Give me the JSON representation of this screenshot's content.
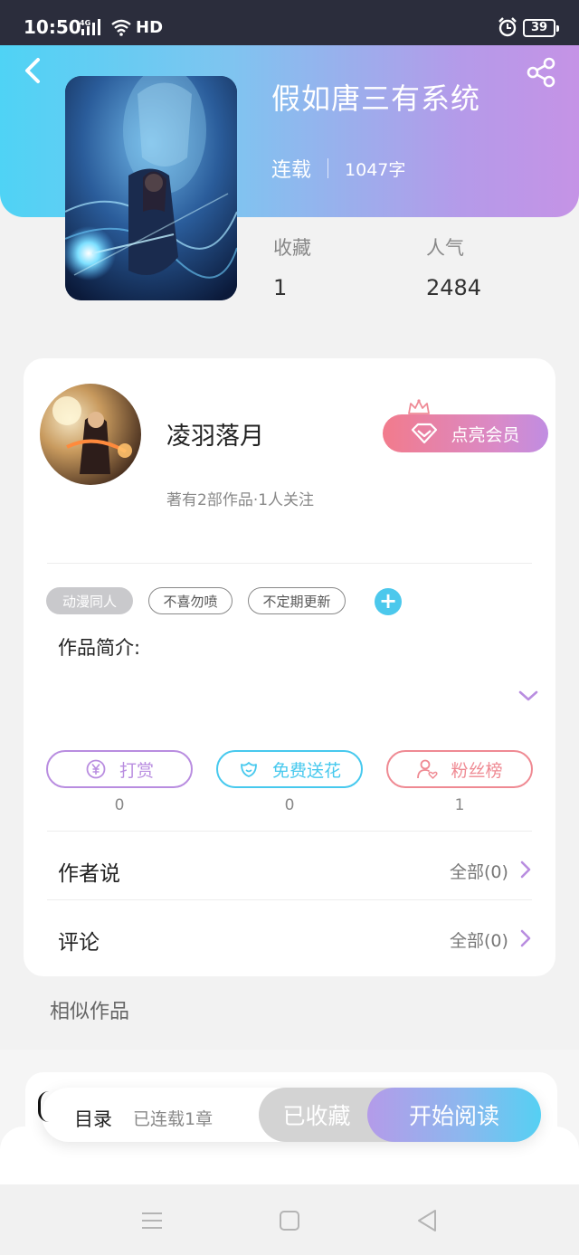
{
  "status_bar": {
    "time": "10:50",
    "network": "4G",
    "hd": "HD",
    "battery": "39"
  },
  "book": {
    "title": "假如唐三有系统",
    "status": "连载",
    "word_count": "1047字",
    "stats": [
      {
        "label": "收藏",
        "value": "1"
      },
      {
        "label": "人气",
        "value": "2484"
      }
    ]
  },
  "author": {
    "name": "凌羽落月",
    "summary": "著有2部作品·1人关注",
    "vip_button": "点亮会员"
  },
  "tags": [
    "动漫同人",
    "不喜勿喷",
    "不定期更新"
  ],
  "intro": {
    "label": "作品简介:"
  },
  "actions": [
    {
      "label": "打赏",
      "count": "0",
      "color": "#b98de0"
    },
    {
      "label": "免费送花",
      "count": "0",
      "color": "#47c9ee"
    },
    {
      "label": "粉丝榜",
      "count": "1",
      "color": "#ef8a93"
    }
  ],
  "rows": [
    {
      "label": "作者说",
      "link": "全部(0)"
    },
    {
      "label": "评论",
      "link": "全部(0)"
    }
  ],
  "similar": {
    "title": "相似作品"
  },
  "read_bar": {
    "toc": "目录",
    "chapters": "已连载1章",
    "collected": "已收藏",
    "start_reading": "开始阅读"
  },
  "colors": {
    "hero_start": "#4fd3f5",
    "hero_end": "#c593e6",
    "vip_gradient_start": "#f27b8c",
    "accent_cyan": "#4cc8ec"
  }
}
